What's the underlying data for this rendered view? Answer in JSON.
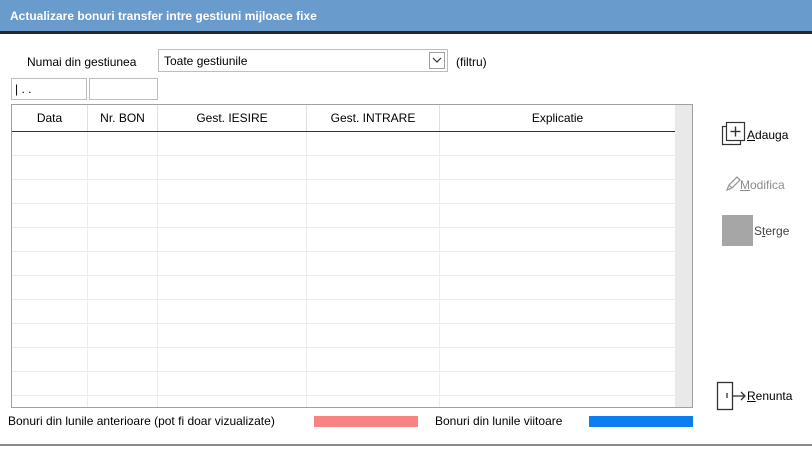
{
  "window": {
    "title": "Actualizare bonuri transfer intre gestiuni mijloace fixe"
  },
  "filter": {
    "label": "Numai din gestiunea",
    "selected": "Toate gestiunile",
    "hint": "(filtru)"
  },
  "date_field": {
    "value": "|  .  ."
  },
  "table": {
    "columns": [
      "Data",
      "Nr. BON",
      "Gest. IESIRE",
      "Gest. INTRARE",
      "Explicatie"
    ],
    "rows": []
  },
  "buttons": {
    "add": "Adauga",
    "modify": "Modifica",
    "delete": "Sterge",
    "cancel": "Renunta"
  },
  "legend": {
    "previous_months": "Bonuri din lunile anterioare (pot fi doar vizualizate)",
    "previous_color": "#f98383",
    "future_months": "Bonuri din lunile viitoare",
    "future_color": "#0d7ef0"
  }
}
